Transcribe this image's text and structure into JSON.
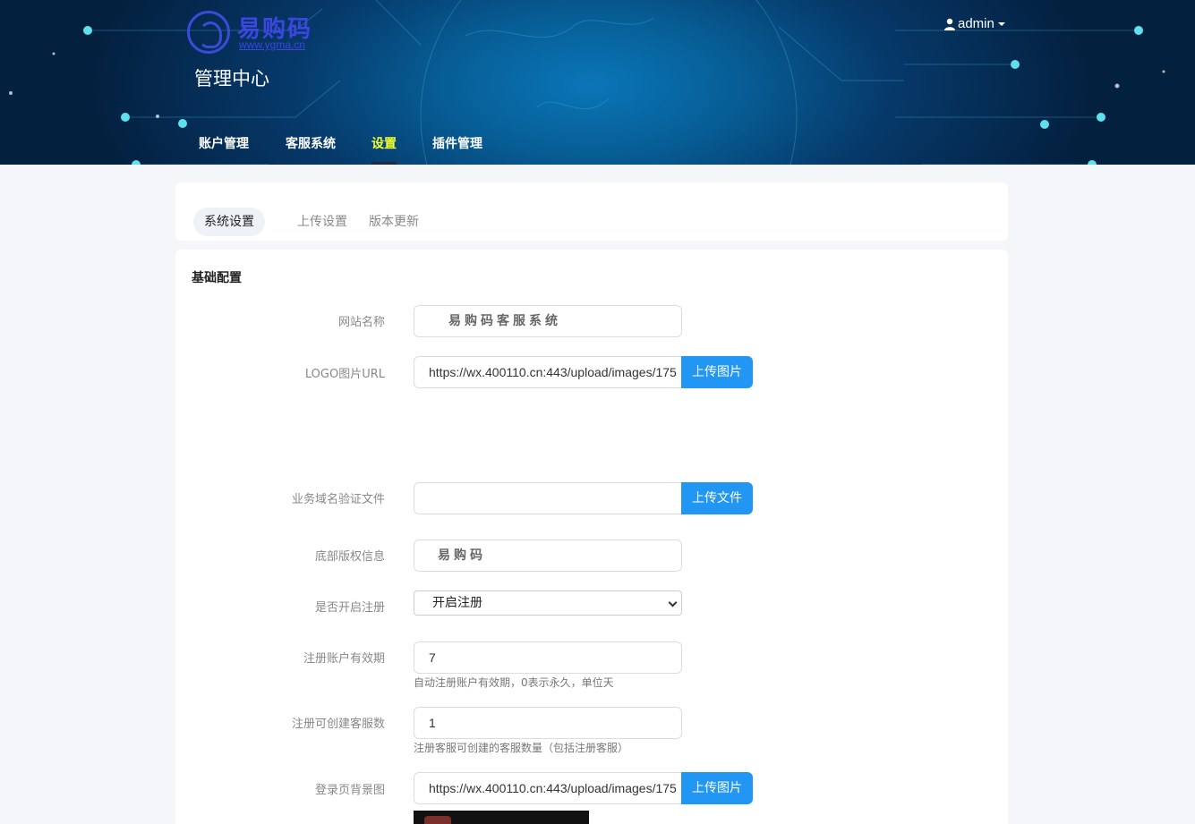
{
  "header": {
    "logo_name": "易购码",
    "logo_url": "www.ygma.cn",
    "title": "管理中心",
    "user": "admin",
    "nav": [
      {
        "label": "账户管理",
        "active": false
      },
      {
        "label": "客服系统",
        "active": false
      },
      {
        "label": "设置",
        "active": true
      },
      {
        "label": "插件管理",
        "active": false
      }
    ]
  },
  "tabs": [
    {
      "label": "系统设置",
      "active": true
    },
    {
      "label": "上传设置",
      "active": false
    },
    {
      "label": "版本更新",
      "active": false
    }
  ],
  "form": {
    "section_title": "基础配置",
    "site_name": {
      "label": "网站名称",
      "value": "易购码客服系统"
    },
    "logo_url": {
      "label": "LOGO图片URL",
      "value": "https://wx.400110.cn:443/upload/images/175",
      "button": "上传图片"
    },
    "domain_file": {
      "label": "业务域名验证文件",
      "value": "",
      "button": "上传文件"
    },
    "copyright": {
      "label": "底部版权信息",
      "value": "易购码"
    },
    "registration": {
      "label": "是否开启注册",
      "value": "开启注册"
    },
    "account_validity": {
      "label": "注册账户有效期",
      "value": "7",
      "hint": "自动注册账户有效期，0表示永久，单位天"
    },
    "service_count": {
      "label": "注册可创建客服数",
      "value": "1",
      "hint": "注册客服可创建的客服数量（包括注册客服）"
    },
    "login_bg": {
      "label": "登录页背景图",
      "value": "https://wx.400110.cn:443/upload/images/175",
      "button": "上传图片"
    }
  },
  "colors": {
    "accent": "#2196f3",
    "nav_active": "#f4ff2e",
    "header_dark": "#04203f"
  },
  "icons": [
    "user-icon",
    "caret-down-icon",
    "select-chevron-icon",
    "logo-icon"
  ]
}
